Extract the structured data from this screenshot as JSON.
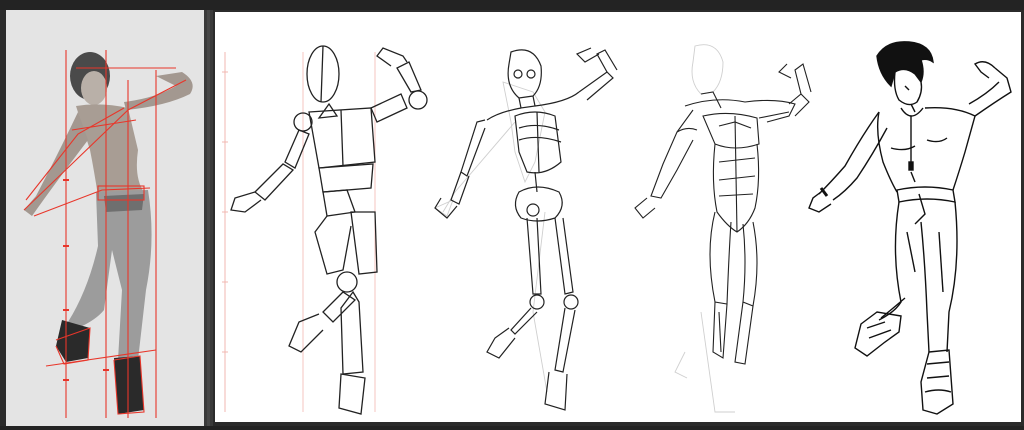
{
  "colors": {
    "app_background": "#2b2b2b",
    "canvas_background": "#ffffff",
    "guide_red": "#e8362a",
    "construction_pink": "#f2b7b0",
    "ink_black": "#111111",
    "light_construction": "#b8b8b8"
  },
  "reference": {
    "description_icon": "photo-reference"
  },
  "canvas": {
    "stages": [
      {
        "id": "mannequin"
      },
      {
        "id": "skeleton"
      },
      {
        "id": "muscles"
      },
      {
        "id": "final-ink"
      }
    ]
  }
}
